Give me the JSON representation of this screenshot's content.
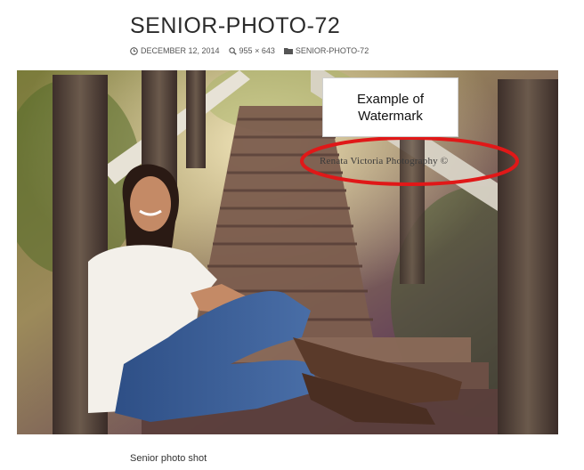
{
  "post": {
    "title": "SENIOR-PHOTO-72",
    "meta": {
      "date": "DECEMBER 12, 2014",
      "dimensions": "955 × 643",
      "category": "SENIOR-PHOTO-72"
    },
    "caption": "Senior photo shot"
  },
  "image": {
    "annotation_box": "Example of Watermark",
    "watermark": "Renata Victoria Photography ©",
    "highlight_color": "#e01818"
  },
  "icons": {
    "date": "clock-icon",
    "dimensions": "magnifier-icon",
    "category": "folder-icon"
  }
}
